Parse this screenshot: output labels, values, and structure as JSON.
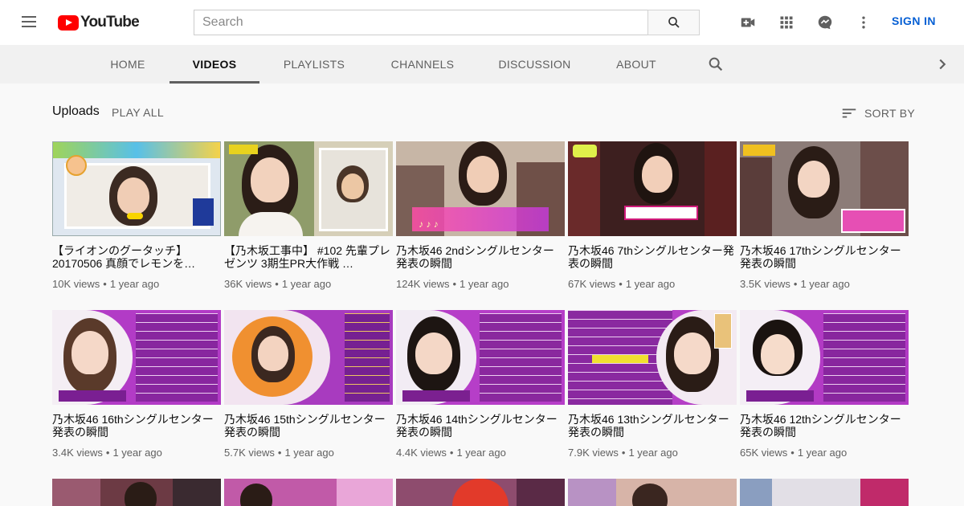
{
  "masthead": {
    "logo_text": "YouTube",
    "search_placeholder": "Search",
    "signin_label": "SIGN IN",
    "icons": [
      "menu-icon",
      "search-icon",
      "create-video-icon",
      "apps-grid-icon",
      "messages-icon",
      "more-vert-icon"
    ]
  },
  "tabs": [
    {
      "label": "HOME"
    },
    {
      "label": "VIDEOS"
    },
    {
      "label": "PLAYLISTS"
    },
    {
      "label": "CHANNELS"
    },
    {
      "label": "DISCUSSION"
    },
    {
      "label": "ABOUT"
    }
  ],
  "active_tab": "VIDEOS",
  "section": {
    "title": "Uploads",
    "play_all": "PLAY ALL",
    "sort_by": "SORT BY"
  },
  "videos": [
    {
      "title": "【ライオンのグータッチ】20170506 真顔でレモンを…",
      "views": "10K views",
      "age": "1 year ago"
    },
    {
      "title": "【乃木坂工事中】 #102 先輩プレゼンツ 3期生PR大作戦 …",
      "views": "36K views",
      "age": "1 year ago"
    },
    {
      "title": "乃木坂46 2ndシングルセンター発表の瞬間",
      "views": "124K views",
      "age": "1 year ago"
    },
    {
      "title": "乃木坂46 7thシングルセンター発表の瞬間",
      "views": "67K views",
      "age": "1 year ago"
    },
    {
      "title": "乃木坂46 17thシングルセンター発表の瞬間",
      "views": "3.5K views",
      "age": "1 year ago"
    },
    {
      "title": "乃木坂46 16thシングルセンター発表の瞬間",
      "views": "3.4K views",
      "age": "1 year ago"
    },
    {
      "title": "乃木坂46 15thシングルセンター発表の瞬間",
      "views": "5.7K views",
      "age": "1 year ago"
    },
    {
      "title": "乃木坂46 14thシングルセンター発表の瞬間",
      "views": "4.4K views",
      "age": "1 year ago"
    },
    {
      "title": "乃木坂46 13thシングルセンター発表の瞬間",
      "views": "7.9K views",
      "age": "1 year ago"
    },
    {
      "title": "乃木坂46 12thシングルセンター発表の瞬間",
      "views": "65K views",
      "age": "1 year ago"
    }
  ],
  "colors": {
    "brand_red": "#ff0000",
    "link_blue": "#065fd4",
    "tab_bg": "#f1f1f1",
    "page_bg": "#f9f9f9"
  }
}
